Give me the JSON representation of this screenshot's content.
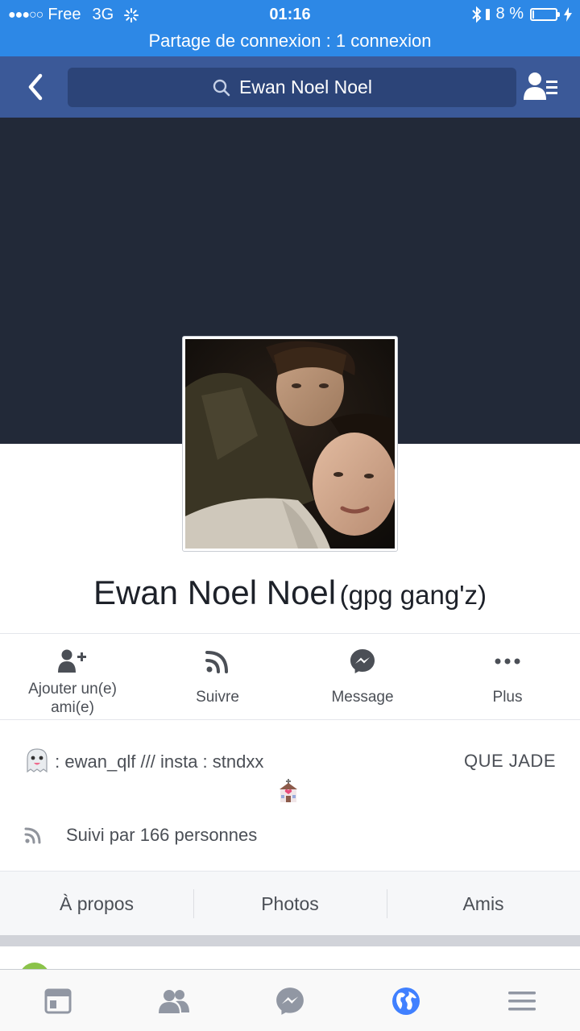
{
  "status_bar": {
    "carrier": "Free",
    "network": "3G",
    "time": "01:16",
    "battery_percent": "8 %",
    "battery_level": 0.08,
    "tethering": "Partage de connexion : 1 connexion"
  },
  "nav": {
    "search_text": "Ewan Noel Noel"
  },
  "profile": {
    "name": "Ewan Noel Noel",
    "alternate_name": "(gpg gang'z)"
  },
  "actions": [
    {
      "label": "Ajouter un(e) ami(e)",
      "icon": "add-friend-icon"
    },
    {
      "label": "Suivre",
      "icon": "follow-rss-icon"
    },
    {
      "label": "Message",
      "icon": "messenger-icon"
    },
    {
      "label": "Plus",
      "icon": "more-dots-icon"
    }
  ],
  "bio": {
    "text": ": ewan_qlf /// insta : stndxx",
    "right_text": "QUE JADE",
    "followers": "Suivi par 166 personnes"
  },
  "tabs": [
    {
      "label": "À propos"
    },
    {
      "label": "Photos"
    },
    {
      "label": "Amis"
    }
  ],
  "bottom_bar": [
    {
      "icon": "news-feed-icon"
    },
    {
      "icon": "friends-icon"
    },
    {
      "icon": "messenger-icon"
    },
    {
      "icon": "notifications-globe-icon",
      "active": true
    },
    {
      "icon": "menu-icon"
    }
  ],
  "colors": {
    "status_bar": "#2d88e6",
    "nav_bar": "#3b5998",
    "cover": "#222938",
    "active_tab": "#4080ff",
    "inactive_icon": "#9197a3"
  }
}
